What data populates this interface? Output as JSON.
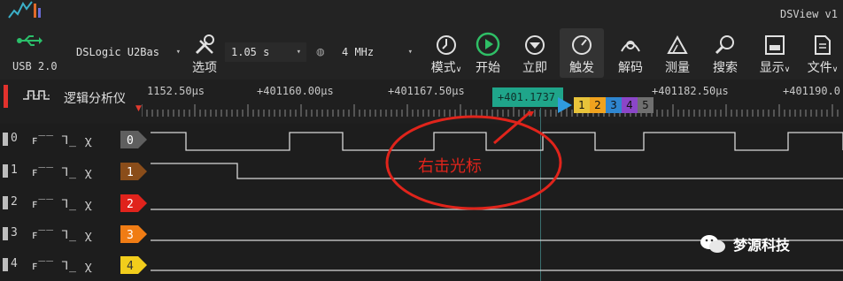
{
  "app": {
    "title": "DSView v1"
  },
  "toolbar": {
    "usb_label": "USB 2.0",
    "device_value": "DSLogic U2Bas",
    "options_label": "选项",
    "duration_value": "1.05 s",
    "rate_value": "4 MHz",
    "mode_label": "模式",
    "start_label": "开始",
    "instant_label": "立即",
    "trigger_label": "触发",
    "decode_label": "解码",
    "measure_label": "测量",
    "search_label": "搜索",
    "display_label": "显示",
    "file_label": "文件"
  },
  "protocol": {
    "label": "逻辑分析仪"
  },
  "timeline": {
    "ticks": [
      "1152.50μs",
      "+401160.00μs",
      "+401167.50μs",
      "+401182.50μs",
      "+401190.0"
    ],
    "cursor_readout": "+401.1737",
    "cursor_buttons": [
      "1",
      "2",
      "3",
      "4",
      "5"
    ],
    "cursor_button_colors": [
      "#e8c33a",
      "#f0a21e",
      "#2f86d0",
      "#8b46c8",
      "#6f6f6f"
    ]
  },
  "channels": [
    {
      "index": "0",
      "tag": "0",
      "color": "#5f5f5f",
      "trigger_icons": "ꜰ‾‾ ⅂_ ꭓ"
    },
    {
      "index": "1",
      "tag": "1",
      "color": "#8a4d1a",
      "trigger_icons": "ꜰ‾‾ ⅂_ ꭓ"
    },
    {
      "index": "2",
      "tag": "2",
      "color": "#e0231c",
      "trigger_icons": "ꜰ‾‾ ⅂_ ꭓ"
    },
    {
      "index": "3",
      "tag": "3",
      "color": "#f07c14",
      "trigger_icons": "ꜰ‾‾ ⅂_ ꭓ"
    },
    {
      "index": "4",
      "tag": "4",
      "color": "#f2cd1c",
      "trigger_icons": "ꜰ‾‾ ⅂_ ꭓ"
    }
  ],
  "annotation": {
    "text": "右击光标",
    "color": "#e0241b"
  },
  "watermark": {
    "text": "梦源科技"
  }
}
